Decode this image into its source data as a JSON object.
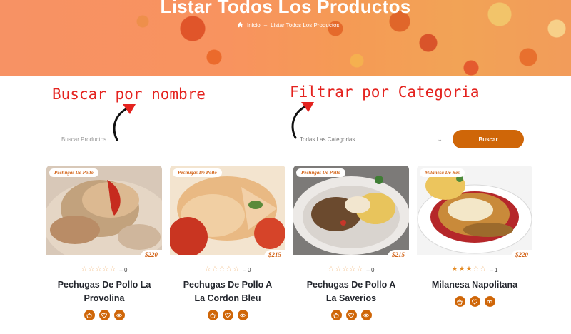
{
  "hero": {
    "title": "Listar Todos Los Productos",
    "breadcrumb": {
      "home_label": "Inicio",
      "separator": "–",
      "current": "Listar Todos Los Productos"
    }
  },
  "annotations": {
    "search_note": "Buscar por nombre",
    "filter_note": "Filtrar por Categoria",
    "color": "#e4231f"
  },
  "filters": {
    "search_placeholder": "Buscar Productos",
    "category_selected": "Todas Las Categorias",
    "submit_label": "Buscar"
  },
  "colors": {
    "accent": "#cf6608",
    "badge_text": "#d3651a",
    "star": "#e48a22"
  },
  "products": [
    {
      "category": "Pechugas De Pollo",
      "price": "$220",
      "rating": 0,
      "rating_count": "0",
      "rating_text": "– 0",
      "name_line1": "Pechugas De Pollo La",
      "name_line2": "Provolina"
    },
    {
      "category": "Pechugas De Pollo",
      "price": "$215",
      "rating": 0,
      "rating_count": "0",
      "rating_text": "– 0",
      "name_line1": "Pechugas De Pollo A",
      "name_line2": "La Cordon Bleu"
    },
    {
      "category": "Pechugas De Pollo",
      "price": "$215",
      "rating": 0,
      "rating_count": "0",
      "rating_text": "– 0",
      "name_line1": "Pechugas De Pollo A",
      "name_line2": "La Saverios"
    },
    {
      "category": "Milanesa De Res",
      "price": "$220",
      "rating": 3,
      "rating_count": "1",
      "rating_text": "– 1",
      "name_line1": "Milanesa Napolitana",
      "name_line2": ""
    }
  ],
  "card_icons": [
    "basket-icon",
    "heart-icon",
    "eye-icon"
  ]
}
